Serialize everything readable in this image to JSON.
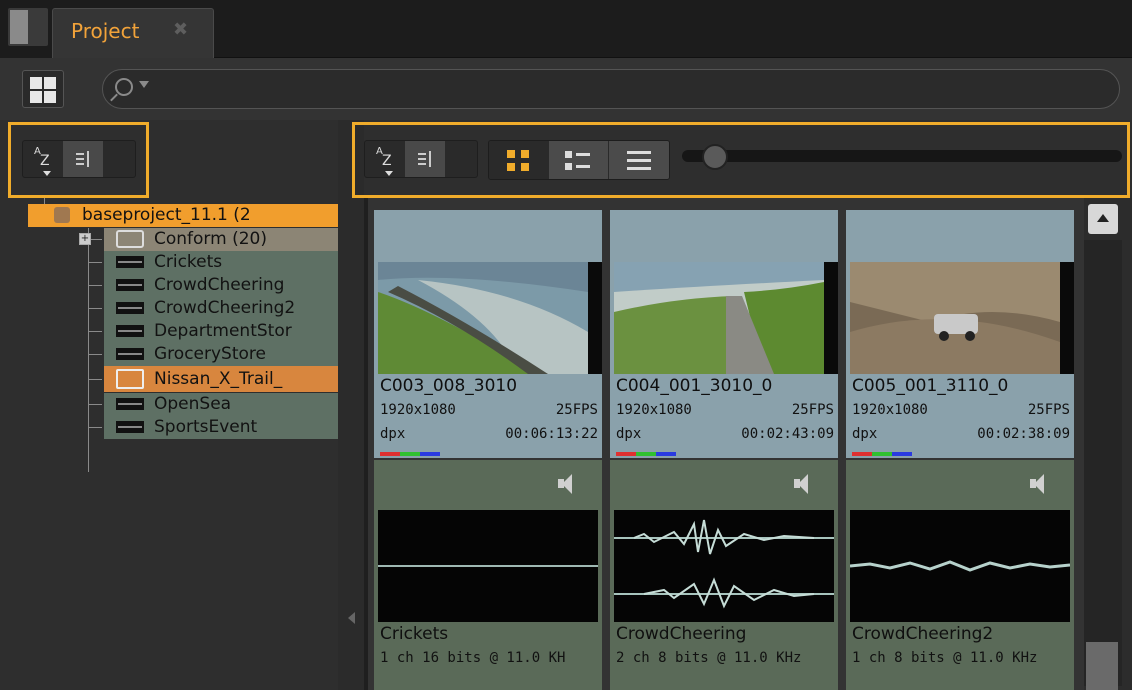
{
  "window": {
    "tab_title": "Project"
  },
  "search": {
    "placeholder": ""
  },
  "bin_tree": {
    "root": "baseproject_11.1 (2",
    "items": [
      {
        "label": "Conform (20)",
        "kind": "folder"
      },
      {
        "label": "Crickets",
        "kind": "audio"
      },
      {
        "label": "CrowdCheering",
        "kind": "audio"
      },
      {
        "label": "CrowdCheering2",
        "kind": "audio"
      },
      {
        "label": "DepartmentStor",
        "kind": "audio"
      },
      {
        "label": "GroceryStore",
        "kind": "audio"
      },
      {
        "label": "Nissan_X_Trail_",
        "kind": "video",
        "selected": true
      },
      {
        "label": "OpenSea",
        "kind": "audio"
      },
      {
        "label": "SportsEvent",
        "kind": "audio"
      }
    ]
  },
  "sort": {
    "az_a": "A",
    "az_z": "Z"
  },
  "view_zoom_level": 0.05,
  "videos": [
    {
      "name": "C003_008_3010",
      "res": "1920x1080",
      "fps": "25FPS",
      "format": "dpx",
      "timecode": "00:06:13:22",
      "thumb": "coast-road"
    },
    {
      "name": "C004_001_3010_0",
      "res": "1920x1080",
      "fps": "25FPS",
      "format": "dpx",
      "timecode": "00:02:43:09",
      "thumb": "coast-aerial"
    },
    {
      "name": "C005_001_3110_0",
      "res": "1920x1080",
      "fps": "25FPS",
      "format": "dpx",
      "timecode": "00:02:38:09",
      "thumb": "suv-rocks"
    }
  ],
  "audio": [
    {
      "name": "Crickets",
      "info": "1 ch 16 bits @ 11.0 KH"
    },
    {
      "name": "CrowdCheering",
      "info": "2 ch 8 bits @ 11.0 KHz"
    },
    {
      "name": "CrowdCheering2",
      "info": "1 ch 8 bits @ 11.0 KHz"
    }
  ],
  "colors": {
    "accent": "#f0ac2b",
    "tab_text": "#f2a33a",
    "selected_bin": "#f19e2d"
  }
}
